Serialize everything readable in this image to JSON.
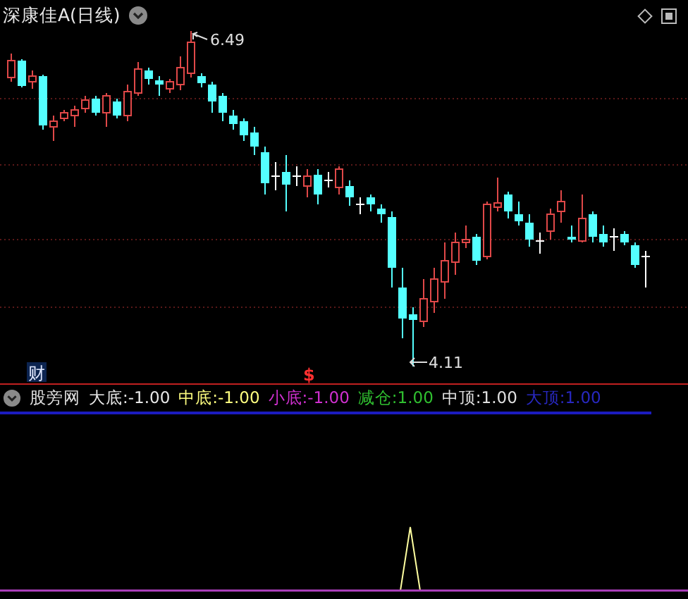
{
  "chart": {
    "title": "深康佳A(日线)",
    "high_label": "6.49",
    "low_label": "4.11",
    "finance_marker": "财",
    "event_marker": "$"
  },
  "indicator": {
    "name": "股旁网",
    "items": [
      {
        "label": "大底:",
        "value": "-1.00",
        "color": "#e8e8e8"
      },
      {
        "label": "中底:",
        "value": "-1.00",
        "color": "#ffff80"
      },
      {
        "label": "小底:",
        "value": "-1.00",
        "color": "#d030d0"
      },
      {
        "label": "减仓:",
        "value": "1.00",
        "color": "#30c030"
      },
      {
        "label": "中顶:",
        "value": "1.00",
        "color": "#e0e0e0"
      },
      {
        "label": "大顶:",
        "value": "1.00",
        "color": "#2828c0"
      }
    ]
  }
}
